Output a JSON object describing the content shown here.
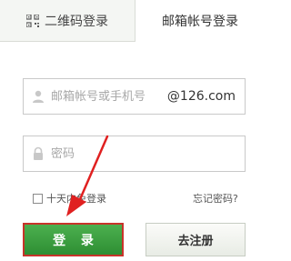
{
  "tabs": {
    "qr_label": "二维码登录",
    "mail_label": "邮箱帐号登录"
  },
  "account": {
    "placeholder": "邮箱帐号或手机号",
    "value": "",
    "domain_suffix": "@126.com"
  },
  "password": {
    "placeholder": "密码",
    "value": ""
  },
  "remember": {
    "label": "十天内免登录",
    "checked": false
  },
  "forgot_link": "忘记密码?",
  "buttons": {
    "login": "登 录",
    "register": "去注册"
  },
  "colors": {
    "login_green": "#3a9e3e",
    "highlight_red": "#e02020",
    "tab_inactive_bg": "#f4f6f3"
  },
  "icons": {
    "qr": "qr-code-icon",
    "user": "user-icon",
    "lock": "lock-icon",
    "annotation": "red-arrow"
  }
}
